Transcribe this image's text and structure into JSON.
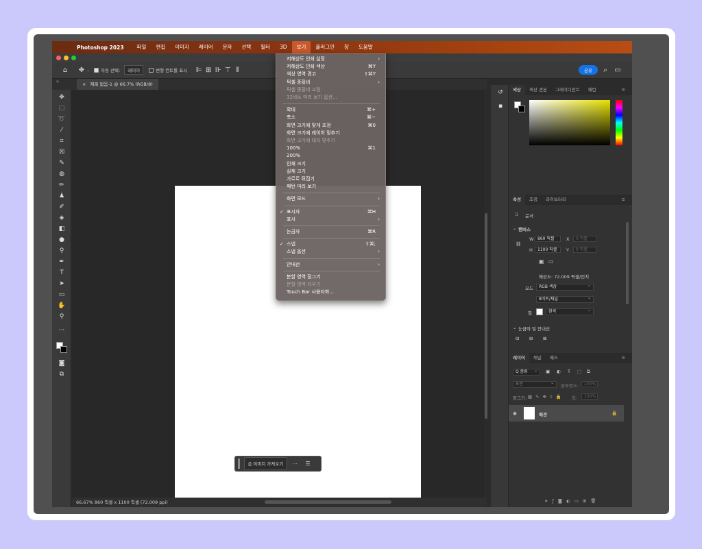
{
  "menubar": {
    "app_name": "Photoshop 2023",
    "items": [
      "파일",
      "편집",
      "이미지",
      "레이어",
      "문자",
      "선택",
      "필터",
      "3D",
      "보기",
      "플러그인",
      "창",
      "도움말"
    ]
  },
  "options_bar": {
    "auto_select_label": "자동 선택:",
    "auto_select_value": "레이어",
    "transform_label": "변형 컨트롤 표시",
    "share_label": "공유"
  },
  "document": {
    "tab_title": "제목 없음-1 @ 66.7% (RGB/8)",
    "status": "66.67%   860 픽셀 x 1100 픽셀 (72.009 ppi)"
  },
  "context_bar": {
    "import_label": "이미지 가져오기",
    "more_label": "···"
  },
  "color_panel": {
    "tabs": [
      "색상",
      "색상 견본",
      "그레이디언트",
      "패턴"
    ]
  },
  "properties_panel": {
    "tabs": [
      "속성",
      "조정",
      "라이브러리"
    ],
    "doc_label": "문서",
    "canvas_label": "캔버스",
    "w_label": "W",
    "w_value": "860 픽셀",
    "h_label": "H",
    "h_value": "1100 픽셀",
    "x_label": "X",
    "x_value": "0 픽셀",
    "y_label": "Y",
    "y_value": "0 픽셀",
    "resolution": "해상도: 72.009 픽셀/인치",
    "mode_label": "모드",
    "mode_value": "RGB 색상",
    "bits_value": "8비트/채널",
    "fill_label": "칠",
    "fill_value": "흰색",
    "rulers_label": "눈금자 및 안내선"
  },
  "layers_panel": {
    "tabs": [
      "레이어",
      "채널",
      "패스"
    ],
    "kind_label": "Q 종류",
    "blend_value": "표준",
    "opacity_label": "불투명도:",
    "opacity_value": "100%",
    "lock_label": "잠그기:",
    "fill_label": "칠:",
    "fill_value": "100%",
    "layer_name": "배경"
  },
  "view_menu": {
    "items": [
      {
        "label": "저해상도 인쇄 설정",
        "shortcut": "",
        "submenu": true,
        "disabled": false,
        "checked": false
      },
      {
        "label": "저해상도 인쇄 색상",
        "shortcut": "⌘Y",
        "submenu": false,
        "disabled": false,
        "checked": false
      },
      {
        "label": "색상 영역 경고",
        "shortcut": "⇧⌘Y",
        "submenu": false,
        "disabled": false,
        "checked": false
      },
      {
        "label": "픽셀 종횡비",
        "shortcut": "",
        "submenu": true,
        "disabled": false,
        "checked": false
      },
      {
        "label": "픽셀 종횡비 교정",
        "shortcut": "",
        "submenu": false,
        "disabled": true,
        "checked": false
      },
      {
        "label": "32비트 미리 보기 옵션...",
        "shortcut": "",
        "submenu": false,
        "disabled": true,
        "checked": false
      },
      {
        "label": "확대",
        "shortcut": "⌘+",
        "submenu": false,
        "disabled": false,
        "checked": false
      },
      {
        "label": "축소",
        "shortcut": "⌘−",
        "submenu": false,
        "disabled": false,
        "checked": false
      },
      {
        "label": "화면 크기에 맞게 조정",
        "shortcut": "⌘0",
        "submenu": false,
        "disabled": false,
        "checked": false
      },
      {
        "label": "화면 크기에 레이어 맞추기",
        "shortcut": "",
        "submenu": false,
        "disabled": false,
        "checked": false
      },
      {
        "label": "화면 크기에 대지 맞추기",
        "shortcut": "",
        "submenu": false,
        "disabled": true,
        "checked": false
      },
      {
        "label": "100%",
        "shortcut": "⌘1",
        "submenu": false,
        "disabled": false,
        "checked": false
      },
      {
        "label": "200%",
        "shortcut": "",
        "submenu": false,
        "disabled": false,
        "checked": false
      },
      {
        "label": "인쇄 크기",
        "shortcut": "",
        "submenu": false,
        "disabled": false,
        "checked": false
      },
      {
        "label": "실제 크기",
        "shortcut": "",
        "submenu": false,
        "disabled": false,
        "checked": false
      },
      {
        "label": "가로로 뒤집기",
        "shortcut": "",
        "submenu": false,
        "disabled": false,
        "checked": false
      },
      {
        "label": "패턴 미리 보기",
        "shortcut": "",
        "submenu": false,
        "disabled": false,
        "checked": false
      },
      {
        "label": "화면 모드",
        "shortcut": "",
        "submenu": true,
        "disabled": false,
        "checked": false
      },
      {
        "label": "표시자",
        "shortcut": "⌘H",
        "submenu": false,
        "disabled": false,
        "checked": true
      },
      {
        "label": "표시",
        "shortcut": "",
        "submenu": true,
        "disabled": false,
        "checked": false
      },
      {
        "label": "눈금자",
        "shortcut": "⌘R",
        "submenu": false,
        "disabled": false,
        "checked": false
      },
      {
        "label": "스냅",
        "shortcut": "⇧⌘;",
        "submenu": false,
        "disabled": false,
        "checked": true
      },
      {
        "label": "스냅 옵션",
        "shortcut": "",
        "submenu": true,
        "disabled": false,
        "checked": false
      },
      {
        "label": "안내선",
        "shortcut": "",
        "submenu": true,
        "disabled": false,
        "checked": false
      },
      {
        "label": "분할 영역 잠그기",
        "shortcut": "",
        "submenu": false,
        "disabled": false,
        "checked": false
      },
      {
        "label": "분할 영역 지우기",
        "shortcut": "",
        "submenu": false,
        "disabled": true,
        "checked": false
      },
      {
        "label": "Touch Bar 사용자화...",
        "shortcut": "",
        "submenu": false,
        "disabled": false,
        "checked": false
      }
    ],
    "separators_after": [
      5,
      16,
      17,
      19,
      20,
      22,
      23
    ]
  },
  "colors": {
    "menubar_accent": "#c9582a",
    "share_blue": "#1473e6"
  }
}
